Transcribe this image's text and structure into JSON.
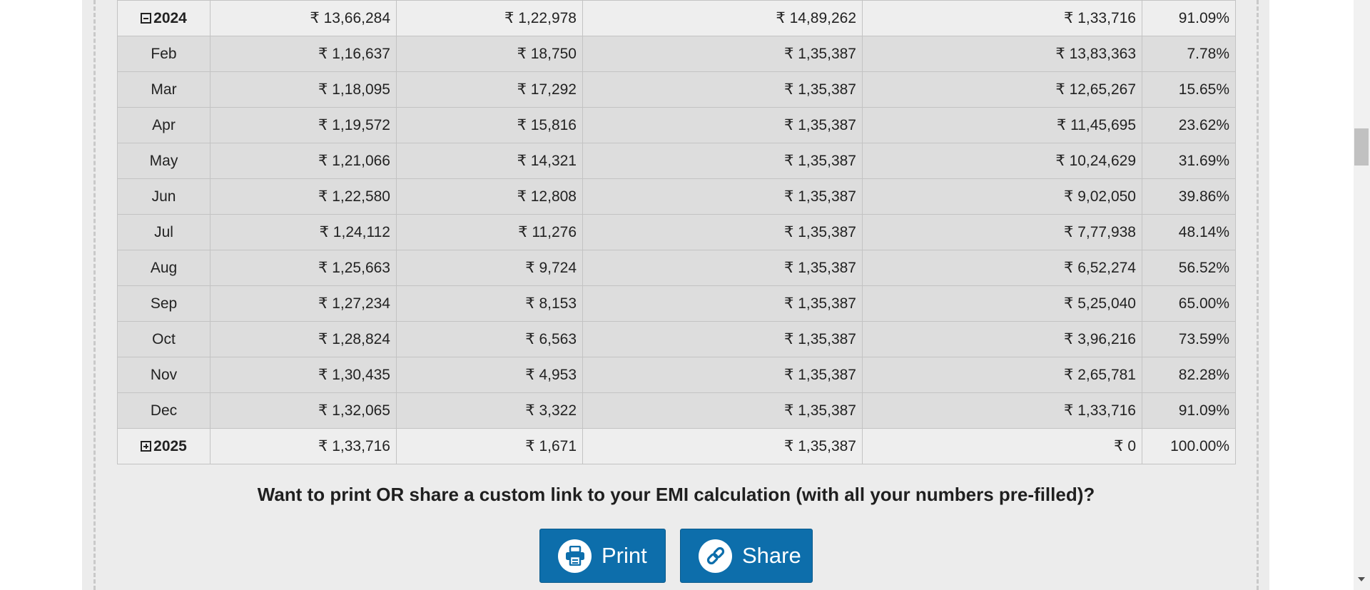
{
  "schedule": {
    "top_year": {
      "period": "2024",
      "principal": "₹ 13,66,284",
      "interest": "₹ 1,22,978",
      "total_payment": "₹ 14,89,262",
      "balance": "₹ 1,33,716",
      "loan_paid": "91.09%"
    },
    "months": [
      {
        "period": "Feb",
        "principal": "₹ 1,16,637",
        "interest": "₹ 18,750",
        "total_payment": "₹ 1,35,387",
        "balance": "₹ 13,83,363",
        "loan_paid": "7.78%"
      },
      {
        "period": "Mar",
        "principal": "₹ 1,18,095",
        "interest": "₹ 17,292",
        "total_payment": "₹ 1,35,387",
        "balance": "₹ 12,65,267",
        "loan_paid": "15.65%"
      },
      {
        "period": "Apr",
        "principal": "₹ 1,19,572",
        "interest": "₹ 15,816",
        "total_payment": "₹ 1,35,387",
        "balance": "₹ 11,45,695",
        "loan_paid": "23.62%"
      },
      {
        "period": "May",
        "principal": "₹ 1,21,066",
        "interest": "₹ 14,321",
        "total_payment": "₹ 1,35,387",
        "balance": "₹ 10,24,629",
        "loan_paid": "31.69%"
      },
      {
        "period": "Jun",
        "principal": "₹ 1,22,580",
        "interest": "₹ 12,808",
        "total_payment": "₹ 1,35,387",
        "balance": "₹ 9,02,050",
        "loan_paid": "39.86%"
      },
      {
        "period": "Jul",
        "principal": "₹ 1,24,112",
        "interest": "₹ 11,276",
        "total_payment": "₹ 1,35,387",
        "balance": "₹ 7,77,938",
        "loan_paid": "48.14%"
      },
      {
        "period": "Aug",
        "principal": "₹ 1,25,663",
        "interest": "₹ 9,724",
        "total_payment": "₹ 1,35,387",
        "balance": "₹ 6,52,274",
        "loan_paid": "56.52%"
      },
      {
        "period": "Sep",
        "principal": "₹ 1,27,234",
        "interest": "₹ 8,153",
        "total_payment": "₹ 1,35,387",
        "balance": "₹ 5,25,040",
        "loan_paid": "65.00%"
      },
      {
        "period": "Oct",
        "principal": "₹ 1,28,824",
        "interest": "₹ 6,563",
        "total_payment": "₹ 1,35,387",
        "balance": "₹ 3,96,216",
        "loan_paid": "73.59%"
      },
      {
        "period": "Nov",
        "principal": "₹ 1,30,435",
        "interest": "₹ 4,953",
        "total_payment": "₹ 1,35,387",
        "balance": "₹ 2,65,781",
        "loan_paid": "82.28%"
      },
      {
        "period": "Dec",
        "principal": "₹ 1,32,065",
        "interest": "₹ 3,322",
        "total_payment": "₹ 1,35,387",
        "balance": "₹ 1,33,716",
        "loan_paid": "91.09%"
      }
    ],
    "bottom_year": {
      "period": "2025",
      "principal": "₹ 1,33,716",
      "interest": "₹ 1,671",
      "total_payment": "₹ 1,35,387",
      "balance": "₹ 0",
      "loan_paid": "100.00%"
    }
  },
  "share_section": {
    "prompt": "Want to print OR share a custom link to your EMI calculation (with all your numbers pre-filled)?",
    "print_label": "Print",
    "share_label": "Share",
    "print_icon": "printer-icon",
    "share_icon": "link-icon"
  },
  "colors": {
    "button_blue": "#0d6eab",
    "month_row_bg": "#dddddd",
    "year_row_bg": "#eeeeee",
    "panel_bg": "#ececec"
  }
}
